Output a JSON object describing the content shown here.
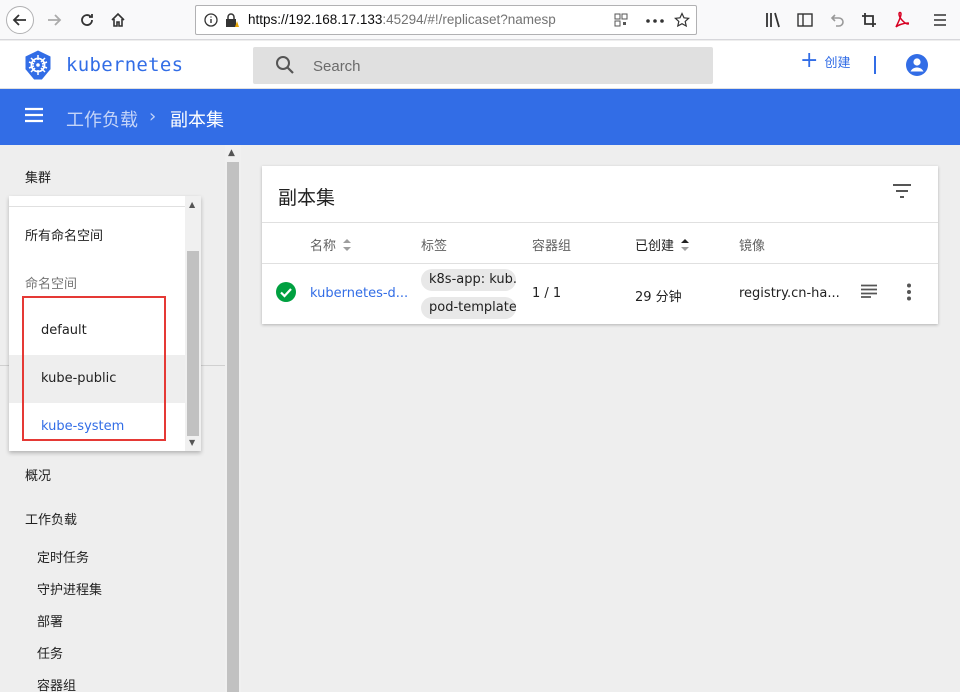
{
  "browser": {
    "url_host": "https://192.168.17.133",
    "url_rest": ":45294/#!/replicaset?namesp"
  },
  "header": {
    "brand": "kubernetes",
    "search_placeholder": "Search",
    "create_label": "创建"
  },
  "toolbar": {
    "breadcrumb_parent": "工作负载",
    "breadcrumb_separator": "›",
    "breadcrumb_current": "副本集"
  },
  "sidebar": {
    "cluster": "集群",
    "overview": "概况",
    "workloads": "工作负载",
    "workload_items": [
      "定时任务",
      "守护进程集",
      "部署",
      "任务",
      "容器组"
    ]
  },
  "namespace_dropdown": {
    "all_label": "所有命名空间",
    "header": "命名空间",
    "items": [
      "default",
      "kube-public",
      "kube-system"
    ],
    "selected": "kube-system",
    "hovered": "kube-public"
  },
  "card": {
    "title": "副本集",
    "columns": {
      "name": "名称",
      "labels": "标签",
      "pods": "容器组",
      "created": "已创建",
      "image": "镜像"
    },
    "rows": [
      {
        "status": "ok",
        "name": "kubernetes-d...",
        "labels": [
          "k8s-app: kub...",
          "pod-template..."
        ],
        "pods": "1 / 1",
        "created": "29 分钟",
        "image": "registry.cn-ha..."
      }
    ]
  },
  "colors": {
    "primary": "#326de6",
    "success": "#00a040",
    "highlight_box": "#e53935"
  }
}
